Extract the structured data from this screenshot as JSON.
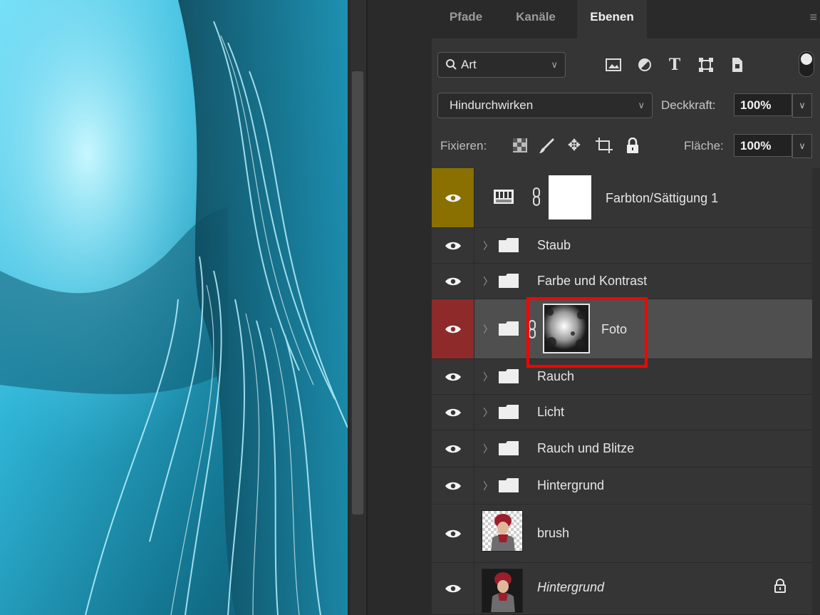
{
  "tabs": [
    {
      "label": "Pfade",
      "active": false
    },
    {
      "label": "Kanäle",
      "active": false
    },
    {
      "label": "Ebenen",
      "active": true
    }
  ],
  "filter": {
    "label": "Art",
    "icons": [
      "image-filter-icon",
      "adjustment-filter-icon",
      "type-filter-icon",
      "shape-filter-icon",
      "smart-object-filter-icon"
    ]
  },
  "blend_mode": "Hindurchwirken",
  "opacity": {
    "label": "Deckkraft:",
    "value": "100%"
  },
  "lock": {
    "label": "Fixieren:",
    "icons": [
      "lock-transparent-icon",
      "lock-paint-icon",
      "lock-move-icon",
      "lock-artboard-icon",
      "lock-all-icon"
    ]
  },
  "fill": {
    "label": "Fläche:",
    "value": "100%"
  },
  "layers": [
    {
      "name": "Farbton/Sättigung 1",
      "kind": "adjustment",
      "eye_color": "#8a7000"
    },
    {
      "name": "Staub",
      "kind": "group"
    },
    {
      "name": "Farbe und Kontrast",
      "kind": "group"
    },
    {
      "name": "Foto",
      "kind": "group-masked",
      "eye_color": "#8e2a2a",
      "selected": true,
      "highlight_color": "#ff0000"
    },
    {
      "name": "Rauch",
      "kind": "group"
    },
    {
      "name": "Licht",
      "kind": "group"
    },
    {
      "name": "Rauch und Blitze",
      "kind": "group"
    },
    {
      "name": "Hintergrund",
      "kind": "group"
    },
    {
      "name": "brush",
      "kind": "pixel"
    },
    {
      "name": "Hintergrund",
      "kind": "background",
      "italic": true,
      "locked": true
    }
  ],
  "colors": {
    "canvas_tint": "#27a9c9",
    "panel_bg": "#353535",
    "selection": "#4f4f4f"
  }
}
